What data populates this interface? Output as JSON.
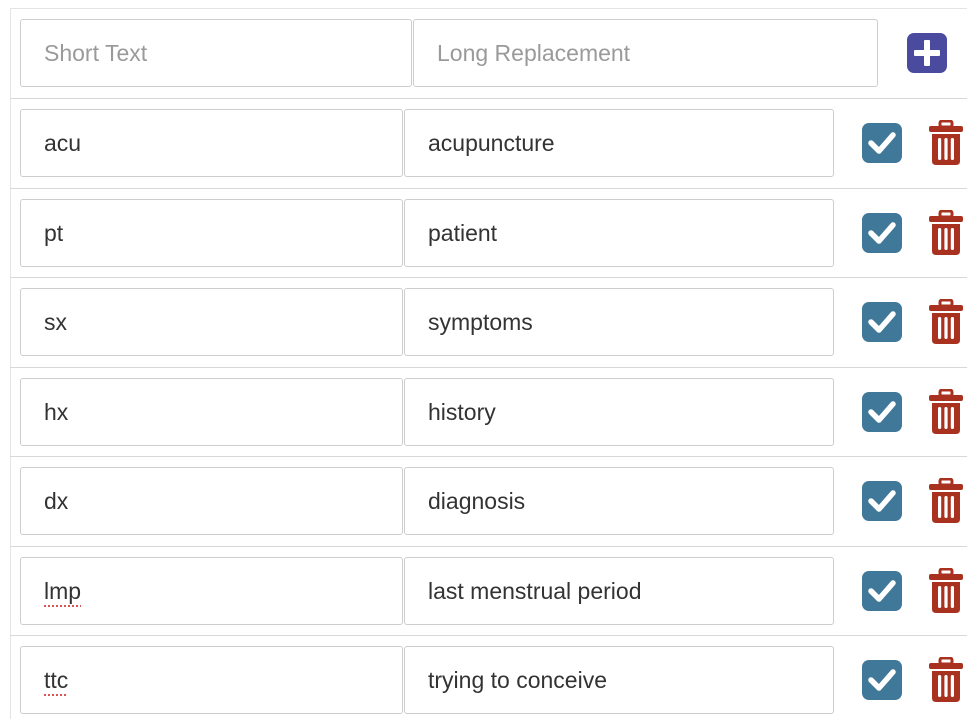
{
  "header": {
    "short_placeholder": "Short Text",
    "long_placeholder": "Long Replacement"
  },
  "rows": [
    {
      "short": "acu",
      "long": "acupuncture",
      "spellcheck": false
    },
    {
      "short": "pt",
      "long": "patient",
      "spellcheck": false
    },
    {
      "short": "sx",
      "long": "symptoms",
      "spellcheck": false
    },
    {
      "short": "hx",
      "long": "history",
      "spellcheck": false
    },
    {
      "short": "dx",
      "long": "diagnosis",
      "spellcheck": false
    },
    {
      "short": "lmp",
      "long": "last menstrual period",
      "spellcheck": true
    },
    {
      "short": "ttc",
      "long": "trying to conceive",
      "spellcheck": true
    }
  ],
  "colors": {
    "add": "#4a4a9e",
    "check": "#3f7899",
    "trash": "#a8321f"
  },
  "icons": {
    "add": "plus-square-icon",
    "save": "check-square-icon",
    "delete": "trash-icon"
  }
}
